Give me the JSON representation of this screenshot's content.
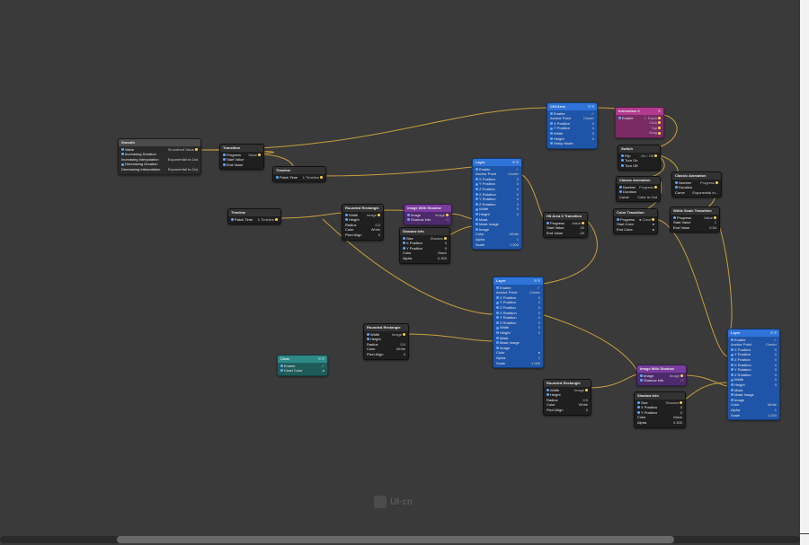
{
  "watermark": "UI·cn",
  "labels": {
    "enable": "Enable",
    "anchor": "Anchor Point",
    "xpos": "X Position",
    "ypos": "Y Position",
    "zpos": "Z Position",
    "xrot": "X Rotation",
    "yrot": "Y Rotation",
    "zrot": "Z Rotation",
    "width": "Width",
    "height": "Height",
    "mask": "Mask",
    "maskimg": "Mask Image",
    "image": "Image",
    "color": "Color",
    "alpha": "Alpha",
    "scale": "Scale",
    "radius": "Radius",
    "pivot": "Pixel Align",
    "value": "Value",
    "smoothed": "Smoothed Value",
    "incdur": "Increasing Duration",
    "incint": "Increasing Interpolation",
    "decdur": "Decreasing Duration",
    "decint": "Decreasing Interpolation",
    "progress": "Progress",
    "startv": "Start Value",
    "endv": "End Value",
    "startc": "Start Color",
    "endc": "End Color",
    "patcht": "Patch Time",
    "timeline": "Timeline",
    "shadow": "Shadow",
    "shadowinfo": "Shadow Info",
    "number": "Number",
    "duration": "Duration",
    "curve": "Curve",
    "flip": "Flip",
    "turnon": "Turn On",
    "turnoff": "Turn Off",
    "onoff": "On / Off",
    "down": "Down",
    "click": "Click",
    "tap": "Tap",
    "drag": "Drag",
    "size": "Size",
    "setup": "Setup Mode",
    "chartcolor": "Chart Color",
    "center": "Center",
    "white": "White",
    "black": "Black",
    "expio": "Exponential In-Out",
    "colorinout": "Color In-Out"
  },
  "nodes": {
    "smooth": {
      "title": "Smooth",
      "rows": [
        {
          "l": "Value",
          "lp": 1,
          "r": "Smoothed Value",
          "rp": 1,
          "rv": ""
        },
        {
          "l": "Increasing Duration",
          "lp": 1,
          "rv": ""
        },
        {
          "l": "Increasing Interpolation",
          "rv": "Exponential In-Out"
        },
        {
          "l": "Decreasing Duration",
          "lp": 1,
          "rv": ""
        },
        {
          "l": "Decreasing Interpolation",
          "rv": "Exponential In-Out"
        }
      ]
    },
    "transition": {
      "title": "Transition",
      "rows": [
        {
          "l": "Progress",
          "lp": 1,
          "r": "Value",
          "rp": 1
        },
        {
          "l": "Start Value",
          "lp": 1
        },
        {
          "l": "End Value",
          "lp": 1
        }
      ]
    },
    "timeline1": {
      "title": "Timeline",
      "rows": [
        {
          "l": "Patch Time",
          "lp": 1,
          "r": "Timeline",
          "rp": 1,
          "rv": "1"
        }
      ]
    },
    "timeline2": {
      "title": "Timeline",
      "rows": [
        {
          "l": "Patch Time",
          "lp": 1,
          "r": "Timeline",
          "rp": 1,
          "rv": "1"
        }
      ]
    },
    "rrect1": {
      "title": "Rounded Rectangle",
      "rows": [
        {
          "l": "Width",
          "lp": 1,
          "r": "Image",
          "rp": 1
        },
        {
          "l": "Height",
          "lp": 1
        },
        {
          "l": "Radius",
          "rv": "0.0"
        },
        {
          "l": "Color",
          "rv": "White"
        },
        {
          "l": "Pixel Align",
          "rv": "0"
        }
      ]
    },
    "rrect2": {
      "title": "Rounded Rectangle",
      "rows": [
        {
          "l": "Width",
          "lp": 1,
          "r": "Image",
          "rp": 1
        },
        {
          "l": "Height",
          "lp": 1
        },
        {
          "l": "Radius",
          "rv": "0.0"
        },
        {
          "l": "Color",
          "rv": "White"
        },
        {
          "l": "Pixel Align",
          "rv": "0"
        }
      ]
    },
    "rrect3": {
      "title": "Rounded Rectangle",
      "rows": [
        {
          "l": "Width",
          "lp": 1,
          "r": "Image",
          "rp": 1
        },
        {
          "l": "Height",
          "lp": 1
        },
        {
          "l": "Radius",
          "rv": "0.0"
        },
        {
          "l": "Color",
          "rv": "White"
        },
        {
          "l": "Pixel Align",
          "rv": "0"
        }
      ]
    },
    "clear": {
      "title": "Clear",
      "rows": [
        {
          "l": "Enable",
          "lp": 1,
          "rv": "✓"
        },
        {
          "l": "Chart Color",
          "lp": 1,
          "rv": "●"
        }
      ]
    },
    "imgsh1": {
      "title": "Image With Shadow",
      "rows": [
        {
          "l": "Image",
          "lp": 1,
          "r": "Image",
          "rp": 1
        },
        {
          "l": "Shadow Info",
          "lp": 1,
          "rv": "□"
        }
      ]
    },
    "imgsh2": {
      "title": "Image With Shadow",
      "rows": [
        {
          "l": "Image",
          "lp": 1,
          "r": "Image",
          "rp": 1
        },
        {
          "l": "Shadow Info",
          "lp": 1,
          "rv": "□"
        }
      ]
    },
    "shadow1": {
      "title": "Shadow Info",
      "rows": [
        {
          "l": "Size",
          "lp": 1,
          "r": "Shadow",
          "rp": 1,
          "rv": ""
        },
        {
          "l": "X Position",
          "lp": 1,
          "rv": "0"
        },
        {
          "l": "Y Position",
          "lp": 1,
          "rv": "0"
        },
        {
          "l": "Color",
          "rv": "Black"
        },
        {
          "l": "Alpha",
          "rv": "0.300"
        }
      ]
    },
    "shadow2": {
      "title": "Shadow Info",
      "rows": [
        {
          "l": "Size",
          "lp": 1,
          "r": "Shadow",
          "rp": 1,
          "rv": ""
        },
        {
          "l": "X Position",
          "lp": 1,
          "rv": "0"
        },
        {
          "l": "Y Position",
          "lp": 1,
          "rv": "0"
        },
        {
          "l": "Color",
          "rv": "Black"
        },
        {
          "l": "Alpha",
          "rv": "0.300"
        }
      ]
    },
    "layer1": {
      "title": "Layer",
      "rows": [
        {
          "l": "Enable",
          "lp": 1,
          "rv": "✓"
        },
        {
          "l": "Anchor Point",
          "rv": "Center"
        },
        {
          "l": "X Position",
          "lp": 1,
          "rv": "0"
        },
        {
          "l": "Y Position",
          "lp": 1,
          "rv": "0"
        },
        {
          "l": "Z Position",
          "lp": 1,
          "rv": "0"
        },
        {
          "l": "X Rotation",
          "lp": 1,
          "rv": "0"
        },
        {
          "l": "Y Rotation",
          "lp": 1,
          "rv": "0"
        },
        {
          "l": "Z Rotation",
          "lp": 1,
          "rv": "0"
        },
        {
          "l": "Width",
          "lp": 1,
          "rv": "0"
        },
        {
          "l": "Height",
          "lp": 1,
          "rv": "0"
        },
        {
          "l": "Mask",
          "lp": 1
        },
        {
          "l": "Mask Image",
          "lp": 1
        },
        {
          "l": "Image",
          "lp": 1
        },
        {
          "l": "Color",
          "rv": "White"
        },
        {
          "l": "Alpha",
          "rv": "1"
        },
        {
          "l": "Scale",
          "rv": "1.000"
        }
      ]
    },
    "layer2": {
      "title": "Layer",
      "rows": [
        {
          "l": "Enable",
          "lp": 1,
          "rv": "✓"
        },
        {
          "l": "Anchor Point",
          "rv": "Center"
        },
        {
          "l": "X Position",
          "lp": 1,
          "rv": "0"
        },
        {
          "l": "Y Position",
          "lp": 1,
          "rv": "0"
        },
        {
          "l": "Z Position",
          "lp": 1,
          "rv": "0"
        },
        {
          "l": "X Rotation",
          "lp": 1,
          "rv": "0"
        },
        {
          "l": "Y Rotation",
          "lp": 1,
          "rv": "0"
        },
        {
          "l": "Z Rotation",
          "lp": 1,
          "rv": "0"
        },
        {
          "l": "Width",
          "lp": 1,
          "rv": "0"
        },
        {
          "l": "Height",
          "lp": 1,
          "rv": "0"
        },
        {
          "l": "Mask",
          "lp": 1
        },
        {
          "l": "Mask Image",
          "lp": 1
        },
        {
          "l": "Image",
          "lp": 1
        },
        {
          "l": "Color",
          "rv": "●"
        },
        {
          "l": "Alpha",
          "rv": "1"
        },
        {
          "l": "Scale",
          "rv": "1.000"
        }
      ]
    },
    "layer3": {
      "title": "Layer",
      "rows": [
        {
          "l": "Enable",
          "lp": 1,
          "rv": "✓"
        },
        {
          "l": "Anchor Point",
          "rv": "Center"
        },
        {
          "l": "X Position",
          "lp": 1,
          "rv": "0"
        },
        {
          "l": "Y Position",
          "lp": 1,
          "rv": "0"
        },
        {
          "l": "Z Position",
          "lp": 1,
          "rv": "0"
        },
        {
          "l": "X Rotation",
          "lp": 1,
          "rv": "0"
        },
        {
          "l": "Y Rotation",
          "lp": 1,
          "rv": "0"
        },
        {
          "l": "Z Rotation",
          "lp": 1,
          "rv": "0"
        },
        {
          "l": "Width",
          "lp": 1,
          "rv": "0"
        },
        {
          "l": "Height",
          "lp": 1,
          "rv": "0"
        },
        {
          "l": "Mask",
          "lp": 1
        },
        {
          "l": "Mask Image",
          "lp": 1
        },
        {
          "l": "Image",
          "lp": 1
        },
        {
          "l": "Color",
          "rv": "White"
        },
        {
          "l": "Alpha",
          "rv": "1"
        },
        {
          "l": "Scale",
          "rv": "1.000"
        }
      ]
    },
    "chiarea": {
      "title": "CHI Area",
      "rows": [
        {
          "l": "Enable",
          "lp": 1,
          "rv": "✓"
        },
        {
          "l": "Anchor Point",
          "rv": "Center"
        },
        {
          "l": "X Position",
          "lp": 1,
          "rv": "0"
        },
        {
          "l": "Y Position",
          "lp": 1,
          "rv": "0"
        },
        {
          "l": "Width",
          "lp": 1,
          "rv": "0"
        },
        {
          "l": "Height",
          "lp": 1,
          "rv": "0"
        },
        {
          "l": "Setup Mode",
          "lp": 1
        }
      ]
    },
    "hit": {
      "title": "Hit Area X Transition",
      "rows": [
        {
          "l": "Progress",
          "lp": 1,
          "r": "Value",
          "rp": 1
        },
        {
          "l": "Start Value",
          "rv": "20"
        },
        {
          "l": "End Value",
          "rv": "-20"
        }
      ]
    },
    "colortr": {
      "title": "Color Transition",
      "rows": [
        {
          "l": "Progress",
          "lp": 1,
          "r": "Color",
          "rp": 1,
          "rv": "●"
        },
        {
          "l": "Start Color",
          "rv": "●"
        },
        {
          "l": "End Color",
          "rv": "●"
        }
      ]
    },
    "classic": {
      "title": "Classic Animation",
      "rows": [
        {
          "l": "Number",
          "lp": 1,
          "r": "Progress",
          "rp": 1
        },
        {
          "l": "Duration",
          "lp": 1
        },
        {
          "l": "Curve",
          "rv": "Color In-Out"
        }
      ]
    },
    "classic2": {
      "title": "Classic Animation",
      "rows": [
        {
          "l": "Number",
          "lp": 1,
          "r": "Progress",
          "rp": 1
        },
        {
          "l": "Duration",
          "lp": 1
        },
        {
          "l": "Curve",
          "rv": "Exponential In..."
        }
      ]
    },
    "whitetr": {
      "title": "White Scale Transition",
      "rows": [
        {
          "l": "Progress",
          "lp": 1,
          "r": "Value",
          "rp": 1
        },
        {
          "l": "Start Value",
          "rv": "1"
        },
        {
          "l": "End Value",
          "rv": "0.54"
        }
      ]
    },
    "switch": {
      "title": "Switch",
      "rows": [
        {
          "l": "Flip",
          "lp": 1,
          "r": "On / Off",
          "rp": 1,
          "rv": ""
        },
        {
          "l": "Turn On",
          "lp": 1
        },
        {
          "l": "Turn Off",
          "lp": 1
        }
      ]
    },
    "inter": {
      "title": "Interaction 2",
      "rows": [
        {
          "l": "Enable",
          "lp": 1,
          "rv": "✓",
          "r": "Down",
          "rp": 1
        },
        {
          "l": "",
          "r": "Click",
          "rp": 1
        },
        {
          "l": "",
          "r": "Tap",
          "rp": 1
        },
        {
          "l": "",
          "r": "Drag",
          "rp": 1
        }
      ]
    }
  }
}
